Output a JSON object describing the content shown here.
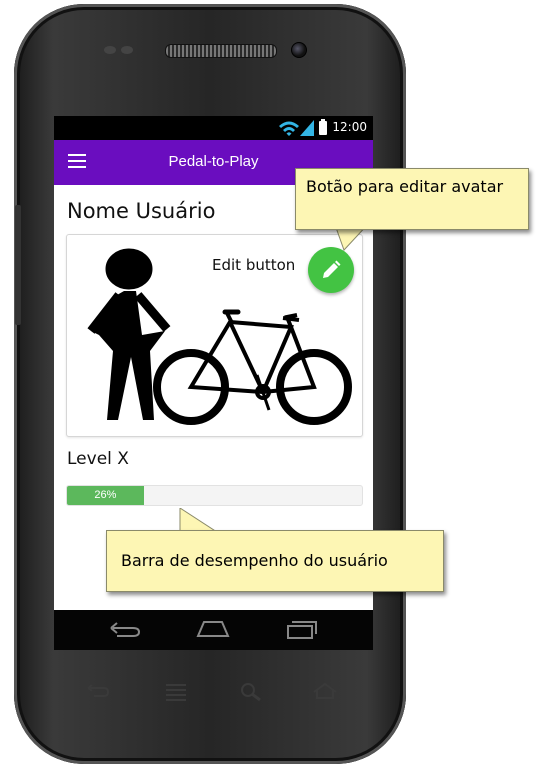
{
  "status_bar": {
    "time": "12:00"
  },
  "app_bar": {
    "title": "Pedal-to-Play",
    "menu_icon": "hamburger-menu-icon"
  },
  "profile": {
    "user_name": "Nome Usuário",
    "edit_label": "Edit button",
    "edit_icon": "pencil-icon"
  },
  "progress": {
    "level_label": "Level X",
    "percent_label": "26%",
    "value": 0.26
  },
  "callouts": {
    "edit_avatar": "Botão para editar avatar",
    "performance_bar": "Barra de desempenho do usuário"
  },
  "nav_bar": {
    "icons": [
      "back-icon",
      "home-icon",
      "recents-icon"
    ]
  },
  "hardware_keys": {
    "icons": [
      "back-icon",
      "menu-icon",
      "search-icon",
      "home-icon"
    ]
  },
  "colors": {
    "app_bar": "#6a0dbf",
    "fab": "#43c343",
    "progress_fill": "#5cb85c",
    "callout_bg": "#fdf6b4"
  }
}
